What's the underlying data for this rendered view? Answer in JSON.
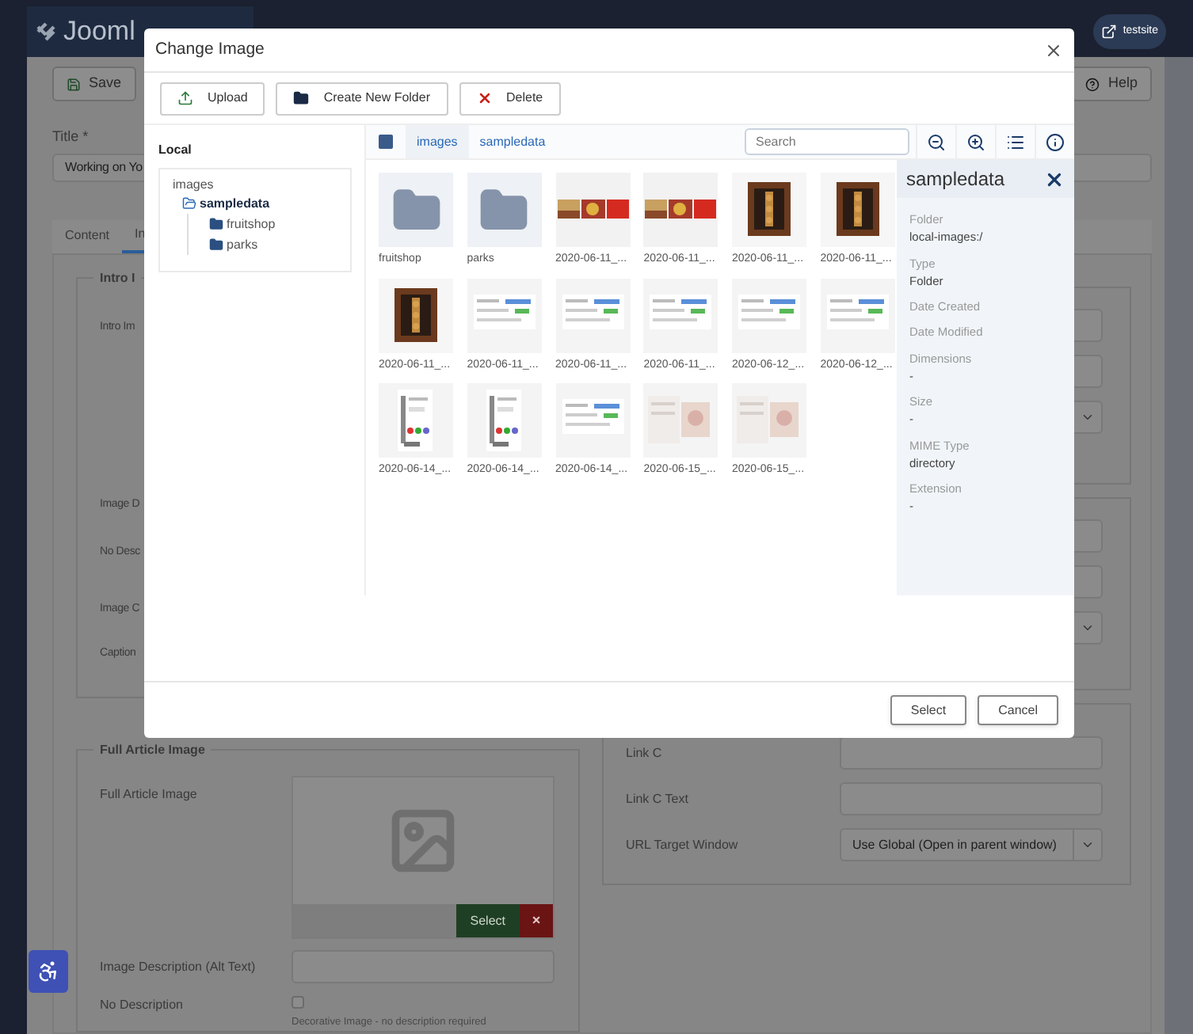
{
  "app_header": {
    "logo": "Jooml",
    "site_button": "testsite"
  },
  "toolbar": {
    "save": "Save",
    "help": "Help"
  },
  "title_field": {
    "label": "Title *",
    "value": "Working on Yo"
  },
  "tabs": [
    {
      "label": "Content",
      "selected": false
    },
    {
      "label": "In",
      "selected": true
    }
  ],
  "intro_fieldset": {
    "legend": "Intro I",
    "labels": [
      "Intro Im",
      "Image D",
      "No Desc",
      "Image C",
      "Caption"
    ]
  },
  "full_image_fieldset": {
    "legend": "Full Article Image",
    "image_label": "Full Article Image",
    "select_button": "Select",
    "clear_button": "×",
    "alt_label": "Image Description (Alt Text)",
    "no_description_label": "No Description",
    "no_description_checked": false,
    "no_description_help": "Decorative Image - no description required"
  },
  "links_fieldset": {
    "rows": [
      {
        "label": "Link C",
        "kind": "input"
      },
      {
        "label": "Link C Text",
        "kind": "input"
      },
      {
        "label": "URL Target Window",
        "kind": "select",
        "value": "Use Global (Open in parent window)"
      }
    ]
  },
  "modal": {
    "title": "Change Image",
    "buttons": [
      {
        "label": "Upload",
        "kind": "upload"
      },
      {
        "label": "Create New Folder",
        "kind": "folder"
      },
      {
        "label": "Delete",
        "kind": "delete"
      }
    ],
    "tree": {
      "heading": "Local",
      "root": "images",
      "children": [
        {
          "label": "sampledata",
          "selected": true,
          "children": [
            {
              "label": "fruitshop",
              "selected": false
            },
            {
              "label": "parks",
              "selected": false
            }
          ]
        }
      ]
    },
    "select_all": {
      "checked": false
    },
    "breadcrumb": [
      "images",
      "sampledata"
    ],
    "search": {
      "placeholder": "Search"
    },
    "items": [
      {
        "kind": "folder",
        "label": "fruitshop"
      },
      {
        "kind": "folder",
        "label": "parks"
      },
      {
        "kind": "picture",
        "label": "2020-06-11_..."
      },
      {
        "kind": "picture",
        "label": "2020-06-11_..."
      },
      {
        "kind": "picture",
        "label": "2020-06-11_..."
      },
      {
        "kind": "picture",
        "label": "2020-06-11_..."
      },
      {
        "kind": "picture",
        "label": "2020-06-11_..."
      },
      {
        "kind": "picture",
        "label": "2020-06-11_..."
      },
      {
        "kind": "picture",
        "label": "2020-06-11_..."
      },
      {
        "kind": "picture",
        "label": "2020-06-11_..."
      },
      {
        "kind": "picture",
        "label": "2020-06-12_..."
      },
      {
        "kind": "picture",
        "label": "2020-06-12_..."
      },
      {
        "kind": "picture",
        "label": "2020-06-14_..."
      },
      {
        "kind": "picture",
        "label": "2020-06-14_..."
      },
      {
        "kind": "picture",
        "label": "2020-06-14_..."
      },
      {
        "kind": "picture",
        "label": "2020-06-15_..."
      },
      {
        "kind": "picture",
        "label": "2020-06-15_..."
      }
    ],
    "info": {
      "title": "sampledata",
      "fields": [
        {
          "label": "Folder",
          "value": "local-images:/"
        },
        {
          "label": "Type",
          "value": "Folder"
        },
        {
          "label": "Date Created"
        },
        {
          "label": "Date Modified"
        },
        {
          "label": "Dimensions",
          "value": "-"
        },
        {
          "label": "Size",
          "value": "-"
        },
        {
          "label": "MIME Type",
          "value": "directory"
        },
        {
          "label": "Extension",
          "value": "-"
        }
      ]
    },
    "footer_buttons": [
      "Select",
      "Cancel"
    ]
  }
}
